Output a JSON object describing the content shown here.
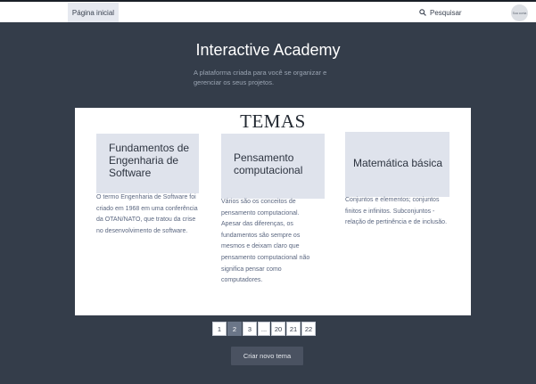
{
  "nav": {
    "home_label": "Página inicial",
    "search_label": "Pesquisar",
    "avatar_text": "Sua conta"
  },
  "hero": {
    "title": "Interactive Academy",
    "subtitle": "A plataforma criada para você se organizar e gerenciar os seus projetos."
  },
  "topics": {
    "title": "TEMAS",
    "cards": [
      {
        "title": "Fundamentos de Engenharia de Software",
        "description": "O termo Engenharia de Software foi criado em 1968 em uma conferência da OTAN/NATO, que tratou da crise no desenvolvimento de software."
      },
      {
        "title": "Pensamento computacional",
        "description": "Vários são os conceitos de pensamento computacional. Apesar das diferenças, os fundamentos são sempre os mesmos e deixam claro que pensamento computacional não significa pensar como computadores."
      },
      {
        "title": "Matemática básica",
        "description": "Conjuntos e elementos; conjuntos finitos e infinitos. Subconjuntos - relação de pertinência e de inclusão."
      }
    ]
  },
  "pagination": {
    "pages": [
      "1",
      "2",
      "3",
      "...",
      "20",
      "21",
      "22"
    ],
    "current": "2"
  },
  "actions": {
    "create_label": "Criar novo tema"
  },
  "colors": {
    "background": "#343d4a",
    "card_header": "#dfe3ec",
    "active_page": "#6b7688",
    "button": "#4a5261"
  }
}
